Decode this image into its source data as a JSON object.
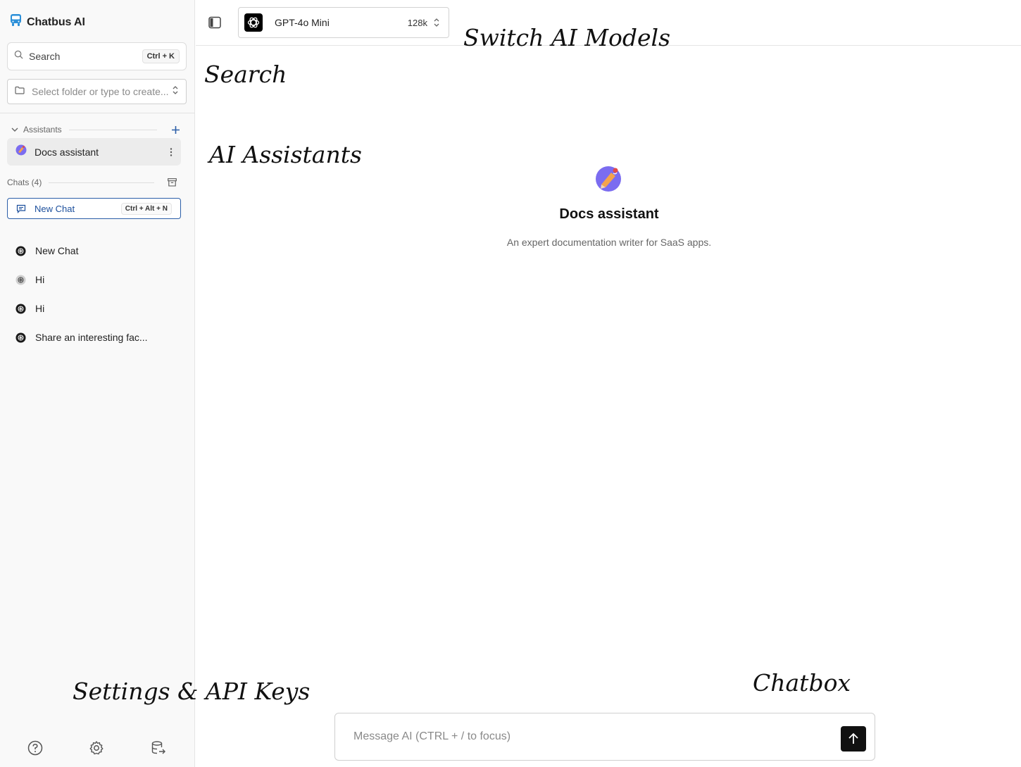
{
  "sidebar": {
    "brand": "Chatbus AI",
    "search": {
      "placeholder": "Search",
      "shortcut": "Ctrl + K"
    },
    "folder": {
      "placeholder": "Select folder or type to create..."
    },
    "assistants": {
      "heading": "Assistants",
      "items": [
        {
          "label": "Docs assistant"
        }
      ]
    },
    "chats": {
      "heading": "Chats (4)",
      "new_chat": {
        "label": "New Chat",
        "shortcut": "Ctrl + Alt + N"
      },
      "items": [
        {
          "label": "New Chat"
        },
        {
          "label": "Hi"
        },
        {
          "label": "Hi"
        },
        {
          "label": "Share an interesting fac..."
        }
      ]
    },
    "footer_icons": [
      "help-icon",
      "settings-icon",
      "database-export-icon"
    ]
  },
  "topbar": {
    "model": {
      "name": "GPT-4o Mini",
      "context": "128k"
    }
  },
  "main": {
    "assistant_title": "Docs assistant",
    "assistant_description": "An expert documentation writer for SaaS apps."
  },
  "composer": {
    "placeholder": "Message AI (CTRL + / to focus)"
  },
  "annotations": {
    "switch_models": "Switch AI Models",
    "search": "Search",
    "assistants": "AI Assistants",
    "settings": "Settings & API Keys",
    "chatbox": "Chatbox"
  },
  "colors": {
    "accent": "#1c4f9c",
    "brand_icon": "#2b8fd8",
    "send_button": "#111111"
  }
}
